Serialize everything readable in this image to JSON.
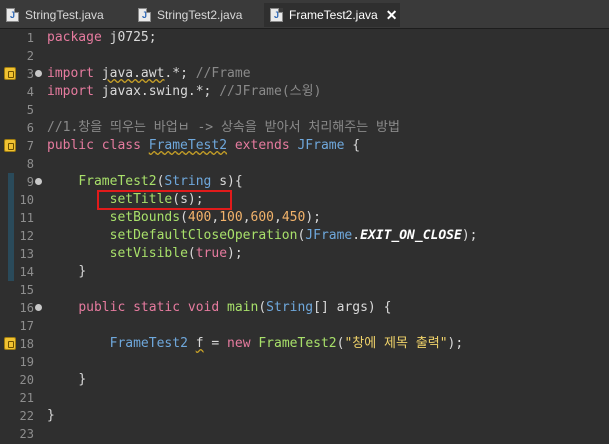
{
  "tabs": [
    {
      "label": "StringTest.java"
    },
    {
      "label": "StringTest2.java"
    },
    {
      "label": "FrameTest2.java",
      "active": true
    }
  ],
  "close_glyph": "✕",
  "line_numbers": [
    "1",
    "2",
    "3",
    "4",
    "5",
    "6",
    "7",
    "8",
    "9",
    "10",
    "11",
    "12",
    "13",
    "14",
    "15",
    "16",
    "17",
    "18",
    "19",
    "20",
    "21",
    "22",
    "23"
  ],
  "code": {
    "l1_kw": "package",
    "l1_rest": " j0725;",
    "l3_kw": "import",
    "l3_pkg": "java.awt",
    "l3_rest": ".*; ",
    "l3_cm": "//Frame",
    "l4_kw": "import",
    "l4_pkg": "javax.swing",
    "l4_rest": ".*; ",
    "l4_cm": "//JFrame(스윙)",
    "l6_cm": "//1.창을 띄우는 바업ㅂ -> 상속을 받아서 처리해주는 방법",
    "l7_kw1": "public class ",
    "l7_cls": "FrameTest2",
    "l7_kw2": " extends ",
    "l7_ty": "JFrame",
    "l7_rest": " {",
    "l9_fn": "FrameTest2",
    "l9_p1": "(",
    "l9_ty": "String",
    "l9_p2": " s){",
    "l10_fn": "setTitle",
    "l10_rest": "(s);",
    "l11_fn": "setBounds",
    "l11_p1": "(",
    "l11_n1": "400",
    "l11_c1": ",",
    "l11_n2": "100",
    "l11_c2": ",",
    "l11_n3": "600",
    "l11_c3": ",",
    "l11_n4": "450",
    "l11_p2": ");",
    "l12_fn": "setDefaultCloseOperation",
    "l12_p1": "(",
    "l12_ty": "JFrame",
    "l12_dot": ".",
    "l12_cn": "EXIT_ON_CLOSE",
    "l12_p2": ");",
    "l13_fn": "setVisible",
    "l13_p1": "(",
    "l13_kw": "true",
    "l13_p2": ");",
    "l14_brace": "}",
    "l16_kw": "public static void ",
    "l16_fn": "main",
    "l16_p1": "(",
    "l16_ty": "String",
    "l16_p2": "[] args) {",
    "l18_ty1": "FrameTest2",
    "l18_sp": " ",
    "l18_var": "f",
    "l18_eq": " = ",
    "l18_kw": "new",
    "l18_sp2": " ",
    "l18_fn": "FrameTest2",
    "l18_p1": "(",
    "l18_st": "\"창에 제목 출력\"",
    "l18_p2": ");",
    "l20_brace": "}",
    "l22_brace": "}"
  }
}
